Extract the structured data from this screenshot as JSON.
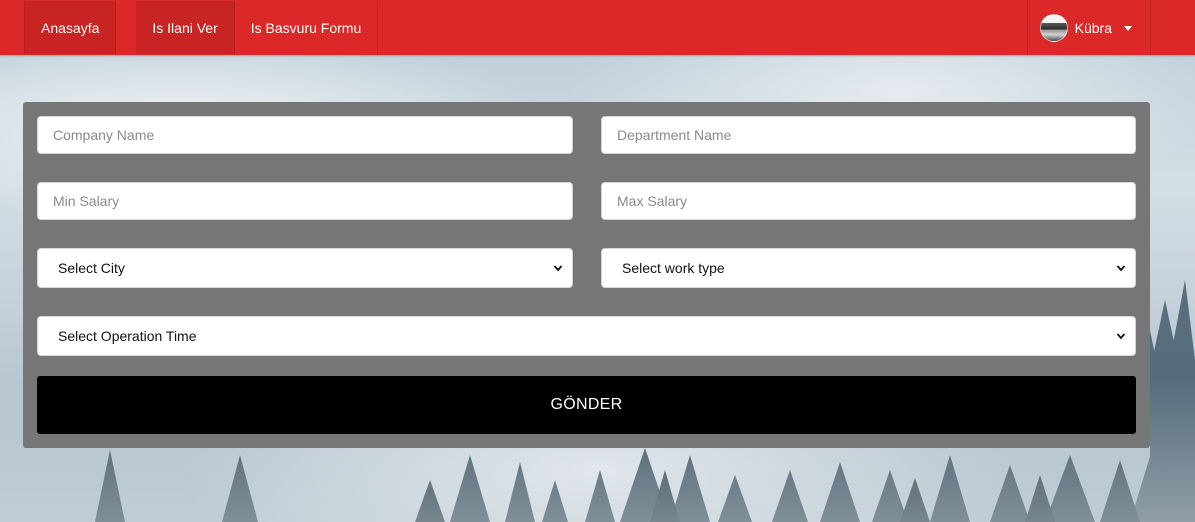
{
  "navbar": {
    "items": [
      {
        "label": "Anasayfa"
      },
      {
        "label": "Is Ilani Ver"
      },
      {
        "label": "Is Basvuru Formu"
      }
    ],
    "user": {
      "name": "Kübra",
      "avatar_icon": "user-avatar",
      "dropdown_icon": "caret-down-icon"
    },
    "color": "#db2828"
  },
  "form": {
    "company_name": {
      "placeholder": "Company Name",
      "value": ""
    },
    "department_name": {
      "placeholder": "Department Name",
      "value": ""
    },
    "min_salary": {
      "placeholder": "Min Salary",
      "value": ""
    },
    "max_salary": {
      "placeholder": "Max Salary",
      "value": ""
    },
    "city": {
      "selected": "Select City",
      "icon": "chevron-down-icon"
    },
    "work_type": {
      "selected": "Select work type",
      "icon": "chevron-down-icon"
    },
    "operation_time": {
      "selected": "Select Operation Time",
      "icon": "chevron-down-icon"
    },
    "submit_label": "GÖNDER",
    "panel_color": "#767676",
    "button_color": "#000000"
  }
}
